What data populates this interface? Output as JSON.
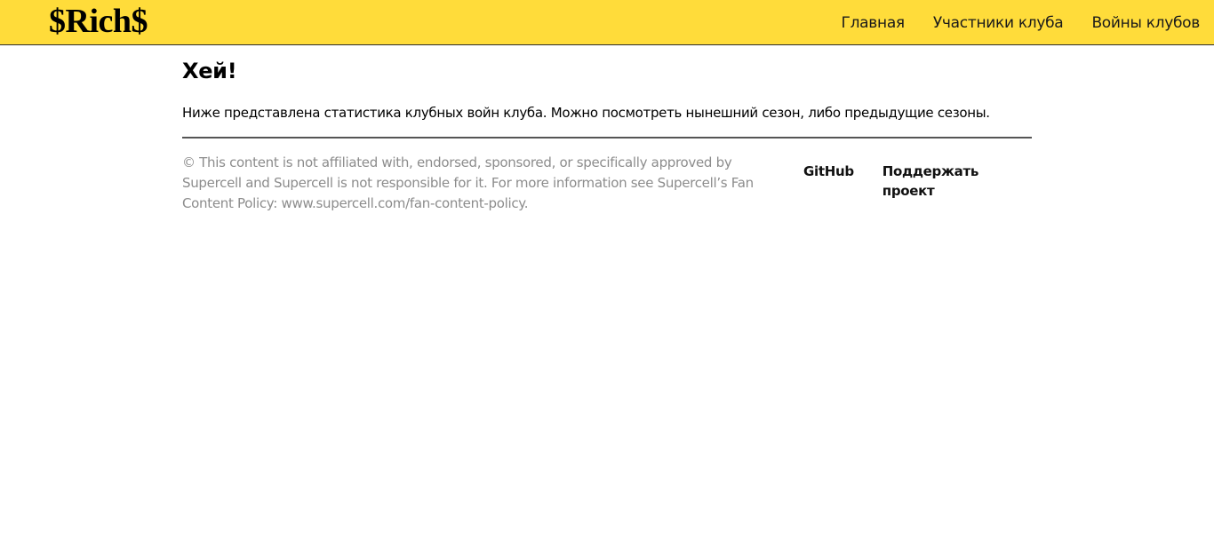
{
  "colors": {
    "navbar_bg": "#ffdc3a",
    "text": "#000000",
    "disclaimer_text": "#8c8c8c",
    "divider": "#555555"
  },
  "navbar": {
    "brand": "$Rich$",
    "links": [
      {
        "label": "Главная"
      },
      {
        "label": "Участники клуба"
      },
      {
        "label": "Войны клубов"
      }
    ]
  },
  "main": {
    "heading": "Хей!",
    "intro": "Ниже представлена статистика клубных войн клуба. Можно посмотреть нынешний сезон, либо предыдущие сезоны."
  },
  "footer": {
    "disclaimer": "© This content is not affiliated with, endorsed, sponsored, or specifically approved by Supercell and Supercell is not responsible for it. For more information see Supercell’s Fan Content Policy: www.supercell.com/fan-content-policy.",
    "links": [
      {
        "label": "GitHub"
      },
      {
        "label": "Поддержать проект"
      }
    ]
  }
}
